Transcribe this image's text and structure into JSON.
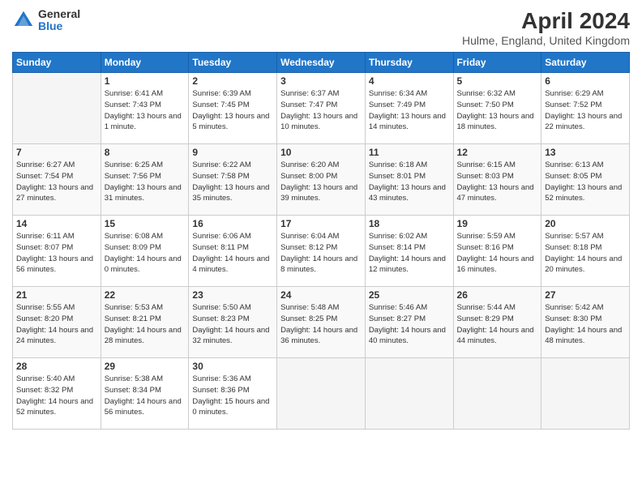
{
  "logo": {
    "general": "General",
    "blue": "Blue"
  },
  "header": {
    "month_year": "April 2024",
    "location": "Hulme, England, United Kingdom"
  },
  "days_of_week": [
    "Sunday",
    "Monday",
    "Tuesday",
    "Wednesday",
    "Thursday",
    "Friday",
    "Saturday"
  ],
  "weeks": [
    [
      {
        "day": "",
        "sunrise": "",
        "sunset": "",
        "daylight": ""
      },
      {
        "day": "1",
        "sunrise": "Sunrise: 6:41 AM",
        "sunset": "Sunset: 7:43 PM",
        "daylight": "Daylight: 13 hours and 1 minute."
      },
      {
        "day": "2",
        "sunrise": "Sunrise: 6:39 AM",
        "sunset": "Sunset: 7:45 PM",
        "daylight": "Daylight: 13 hours and 5 minutes."
      },
      {
        "day": "3",
        "sunrise": "Sunrise: 6:37 AM",
        "sunset": "Sunset: 7:47 PM",
        "daylight": "Daylight: 13 hours and 10 minutes."
      },
      {
        "day": "4",
        "sunrise": "Sunrise: 6:34 AM",
        "sunset": "Sunset: 7:49 PM",
        "daylight": "Daylight: 13 hours and 14 minutes."
      },
      {
        "day": "5",
        "sunrise": "Sunrise: 6:32 AM",
        "sunset": "Sunset: 7:50 PM",
        "daylight": "Daylight: 13 hours and 18 minutes."
      },
      {
        "day": "6",
        "sunrise": "Sunrise: 6:29 AM",
        "sunset": "Sunset: 7:52 PM",
        "daylight": "Daylight: 13 hours and 22 minutes."
      }
    ],
    [
      {
        "day": "7",
        "sunrise": "Sunrise: 6:27 AM",
        "sunset": "Sunset: 7:54 PM",
        "daylight": "Daylight: 13 hours and 27 minutes."
      },
      {
        "day": "8",
        "sunrise": "Sunrise: 6:25 AM",
        "sunset": "Sunset: 7:56 PM",
        "daylight": "Daylight: 13 hours and 31 minutes."
      },
      {
        "day": "9",
        "sunrise": "Sunrise: 6:22 AM",
        "sunset": "Sunset: 7:58 PM",
        "daylight": "Daylight: 13 hours and 35 minutes."
      },
      {
        "day": "10",
        "sunrise": "Sunrise: 6:20 AM",
        "sunset": "Sunset: 8:00 PM",
        "daylight": "Daylight: 13 hours and 39 minutes."
      },
      {
        "day": "11",
        "sunrise": "Sunrise: 6:18 AM",
        "sunset": "Sunset: 8:01 PM",
        "daylight": "Daylight: 13 hours and 43 minutes."
      },
      {
        "day": "12",
        "sunrise": "Sunrise: 6:15 AM",
        "sunset": "Sunset: 8:03 PM",
        "daylight": "Daylight: 13 hours and 47 minutes."
      },
      {
        "day": "13",
        "sunrise": "Sunrise: 6:13 AM",
        "sunset": "Sunset: 8:05 PM",
        "daylight": "Daylight: 13 hours and 52 minutes."
      }
    ],
    [
      {
        "day": "14",
        "sunrise": "Sunrise: 6:11 AM",
        "sunset": "Sunset: 8:07 PM",
        "daylight": "Daylight: 13 hours and 56 minutes."
      },
      {
        "day": "15",
        "sunrise": "Sunrise: 6:08 AM",
        "sunset": "Sunset: 8:09 PM",
        "daylight": "Daylight: 14 hours and 0 minutes."
      },
      {
        "day": "16",
        "sunrise": "Sunrise: 6:06 AM",
        "sunset": "Sunset: 8:11 PM",
        "daylight": "Daylight: 14 hours and 4 minutes."
      },
      {
        "day": "17",
        "sunrise": "Sunrise: 6:04 AM",
        "sunset": "Sunset: 8:12 PM",
        "daylight": "Daylight: 14 hours and 8 minutes."
      },
      {
        "day": "18",
        "sunrise": "Sunrise: 6:02 AM",
        "sunset": "Sunset: 8:14 PM",
        "daylight": "Daylight: 14 hours and 12 minutes."
      },
      {
        "day": "19",
        "sunrise": "Sunrise: 5:59 AM",
        "sunset": "Sunset: 8:16 PM",
        "daylight": "Daylight: 14 hours and 16 minutes."
      },
      {
        "day": "20",
        "sunrise": "Sunrise: 5:57 AM",
        "sunset": "Sunset: 8:18 PM",
        "daylight": "Daylight: 14 hours and 20 minutes."
      }
    ],
    [
      {
        "day": "21",
        "sunrise": "Sunrise: 5:55 AM",
        "sunset": "Sunset: 8:20 PM",
        "daylight": "Daylight: 14 hours and 24 minutes."
      },
      {
        "day": "22",
        "sunrise": "Sunrise: 5:53 AM",
        "sunset": "Sunset: 8:21 PM",
        "daylight": "Daylight: 14 hours and 28 minutes."
      },
      {
        "day": "23",
        "sunrise": "Sunrise: 5:50 AM",
        "sunset": "Sunset: 8:23 PM",
        "daylight": "Daylight: 14 hours and 32 minutes."
      },
      {
        "day": "24",
        "sunrise": "Sunrise: 5:48 AM",
        "sunset": "Sunset: 8:25 PM",
        "daylight": "Daylight: 14 hours and 36 minutes."
      },
      {
        "day": "25",
        "sunrise": "Sunrise: 5:46 AM",
        "sunset": "Sunset: 8:27 PM",
        "daylight": "Daylight: 14 hours and 40 minutes."
      },
      {
        "day": "26",
        "sunrise": "Sunrise: 5:44 AM",
        "sunset": "Sunset: 8:29 PM",
        "daylight": "Daylight: 14 hours and 44 minutes."
      },
      {
        "day": "27",
        "sunrise": "Sunrise: 5:42 AM",
        "sunset": "Sunset: 8:30 PM",
        "daylight": "Daylight: 14 hours and 48 minutes."
      }
    ],
    [
      {
        "day": "28",
        "sunrise": "Sunrise: 5:40 AM",
        "sunset": "Sunset: 8:32 PM",
        "daylight": "Daylight: 14 hours and 52 minutes."
      },
      {
        "day": "29",
        "sunrise": "Sunrise: 5:38 AM",
        "sunset": "Sunset: 8:34 PM",
        "daylight": "Daylight: 14 hours and 56 minutes."
      },
      {
        "day": "30",
        "sunrise": "Sunrise: 5:36 AM",
        "sunset": "Sunset: 8:36 PM",
        "daylight": "Daylight: 15 hours and 0 minutes."
      },
      {
        "day": "",
        "sunrise": "",
        "sunset": "",
        "daylight": ""
      },
      {
        "day": "",
        "sunrise": "",
        "sunset": "",
        "daylight": ""
      },
      {
        "day": "",
        "sunrise": "",
        "sunset": "",
        "daylight": ""
      },
      {
        "day": "",
        "sunrise": "",
        "sunset": "",
        "daylight": ""
      }
    ]
  ]
}
